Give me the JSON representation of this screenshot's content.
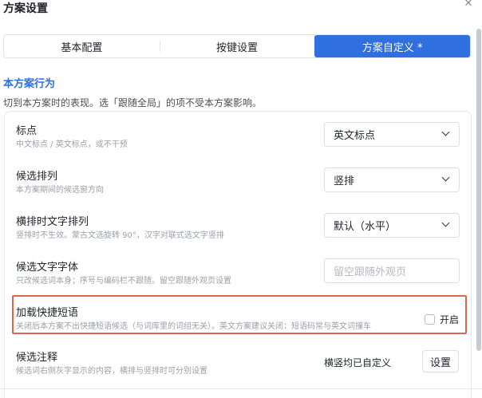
{
  "window": {
    "title": "方案设置"
  },
  "tabs": [
    {
      "label": "基本配置",
      "active": false
    },
    {
      "label": "按键设置",
      "active": false
    },
    {
      "label": "方案自定义 *",
      "active": true
    }
  ],
  "section": {
    "title": "本方案行为",
    "description": "切到本方案时的表现。选「跟随全局」的项不受本方案影响。"
  },
  "settings": [
    {
      "label": "标点",
      "hint": "中文标点 / 英文标点，或不干预",
      "control": "select",
      "value": "英文标点"
    },
    {
      "label": "候选排列",
      "hint": "本方案期间的候选窗方向",
      "control": "select",
      "value": "竖排"
    },
    {
      "label": "横排时文字排列",
      "hint": "竖排时不生效。蒙古文选旋转 90°，汉字对联式选文字竖排",
      "control": "select",
      "value": "默认（水平）"
    },
    {
      "label": "候选文字字体",
      "hint": "只改候选词本身；序号与编码栏不跟随。留空跟随外观页设置",
      "control": "input",
      "value": "",
      "placeholder": "留空跟随外观页"
    },
    {
      "label": "加载快捷短语",
      "hint": "关闭后本方案不出快捷短语候选（与词库里的词组无关）。英文方案建议关闭：短语码常与英文词撞车",
      "control": "checkbox",
      "checked": false,
      "checkbox_label": "开启"
    },
    {
      "label": "候选注释",
      "hint": "候选词右侧灰字显示的内容，横排与竖排时可分别设置",
      "control": "button",
      "value": "横竖均已自定义",
      "button_label": "设置"
    }
  ],
  "colors": {
    "accent": "#2f6fe0",
    "highlight_border": "#d8694e"
  },
  "icons": {
    "close": "close-icon",
    "chevron": "chevron-down-icon"
  }
}
